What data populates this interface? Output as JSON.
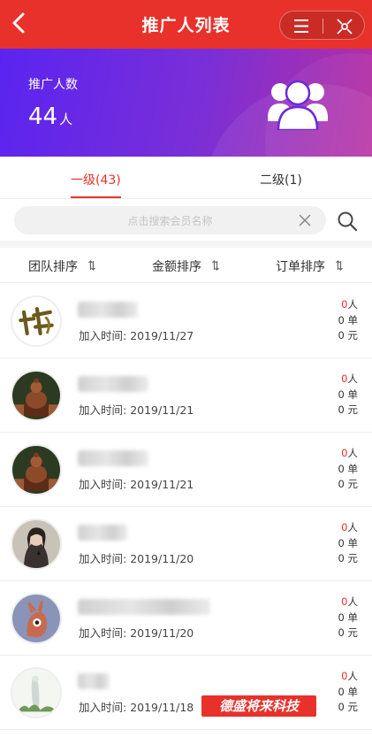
{
  "header": {
    "title": "推广人列表"
  },
  "banner": {
    "label": "推广人数",
    "count": "44",
    "unit": "人"
  },
  "tabs": [
    {
      "label": "一级(43)",
      "active": true
    },
    {
      "label": "二级(1)",
      "active": false
    }
  ],
  "search": {
    "placeholder": "点击搜索会员名称"
  },
  "sort": [
    {
      "label": "团队排序"
    },
    {
      "label": "金额排序"
    },
    {
      "label": "订单排序"
    }
  ],
  "members": [
    {
      "avatar": "calligraphy-logo",
      "join_label": "加入时间: ",
      "join_date": "2019/11/27",
      "people": "0",
      "people_unit": "人",
      "orders": "0 单",
      "amount": "0 元"
    },
    {
      "avatar": "buddha-statue",
      "join_label": "加入时间: ",
      "join_date": "2019/11/21",
      "people": "0",
      "people_unit": "人",
      "orders": "0 单",
      "amount": "0 元"
    },
    {
      "avatar": "buddha-statue",
      "join_label": "加入时间: ",
      "join_date": "2019/11/21",
      "people": "0",
      "people_unit": "人",
      "orders": "0 单",
      "amount": "0 元"
    },
    {
      "avatar": "girl-photo",
      "join_label": "加入时间: ",
      "join_date": "2019/11/20",
      "people": "0",
      "people_unit": "人",
      "orders": "0 单",
      "amount": "0 元"
    },
    {
      "avatar": "cartoon-bird",
      "join_label": "加入时间: ",
      "join_date": "2019/11/20",
      "people": "0",
      "people_unit": "人",
      "orders": "0 单",
      "amount": "0 元"
    },
    {
      "avatar": "landscape-painting",
      "join_label": "加入时间: ",
      "join_date": "2019/11/18",
      "people": "0",
      "people_unit": "人",
      "orders": "0 单",
      "amount": "0 元"
    }
  ],
  "watermark": {
    "text": "德盛将来科技"
  },
  "colors": {
    "primary": "#e8312b",
    "banner_start": "#5a24f0",
    "banner_end": "#b82fa0"
  }
}
